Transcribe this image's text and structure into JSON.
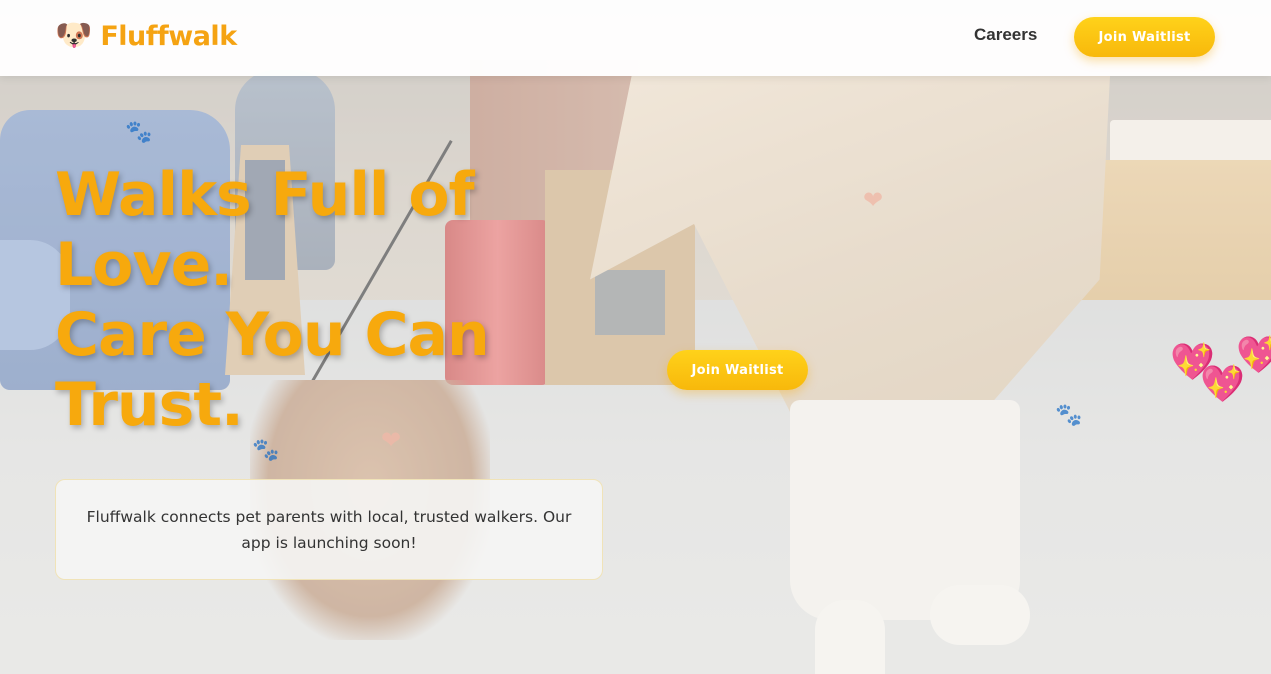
{
  "brand": {
    "name": "Fluffwalk",
    "logo_icon": "🐶"
  },
  "nav": {
    "careers_label": "Careers",
    "cta_label": "Join Waitlist"
  },
  "hero": {
    "title_lines": [
      "Walks Full of",
      "Love.",
      "Care You Can",
      "Trust."
    ],
    "cta_label": "Join Waitlist",
    "description": "Fluffwalk connects pet parents with local, trusted walkers. Our app is launching soon!"
  },
  "decorations": {
    "paw_glyph": "🐾",
    "heart_glyph": "❤",
    "sparkle_heart_glyph": "💖"
  },
  "colors": {
    "brand_orange": "#f5a312",
    "title_orange": "#f7a90d",
    "button_yellow": "#ffd21a",
    "text_dark": "#333333"
  }
}
